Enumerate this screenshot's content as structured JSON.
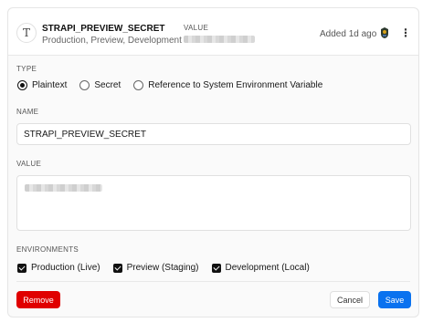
{
  "env_var": {
    "type_icon_glyph": "T",
    "key": "STRAPI_PREVIEW_SECRET",
    "environments_summary": "Production, Preview, Development",
    "value_label": "VALUE",
    "added": "Added 1d ago",
    "avatar_icon": "user-avatar-icon",
    "more_icon": "more-vertical-icon",
    "more_glyph": "⋮"
  },
  "form": {
    "type_label": "TYPE",
    "type_options": [
      "Plaintext",
      "Secret",
      "Reference to System Environment Variable"
    ],
    "type_selected": "Plaintext",
    "name_label": "NAME",
    "name_value": "STRAPI_PREVIEW_SECRET",
    "value_label": "VALUE",
    "environments_label": "ENVIRONMENTS",
    "environments": [
      {
        "label": "Production (Live)",
        "checked": true
      },
      {
        "label": "Preview (Staging)",
        "checked": true
      },
      {
        "label": "Development (Local)",
        "checked": true
      }
    ]
  },
  "actions": {
    "remove": "Remove",
    "cancel": "Cancel",
    "save": "Save"
  },
  "colors": {
    "remove_bg": "#e00000",
    "save_bg": "#0a72ef",
    "checkbox": "#111111"
  }
}
